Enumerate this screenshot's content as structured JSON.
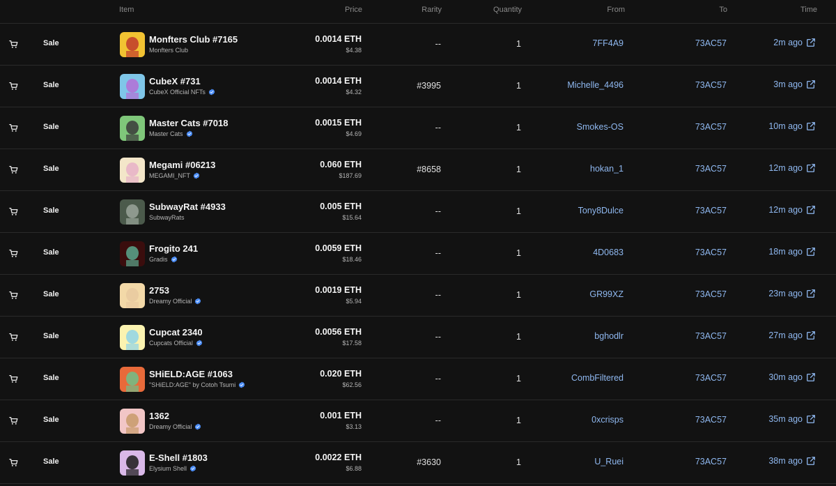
{
  "header": {
    "item": "Item",
    "price": "Price",
    "rarity": "Rarity",
    "quantity": "Quantity",
    "from": "From",
    "to": "To",
    "time": "Time"
  },
  "colors": {
    "background": "#121212",
    "link": "#8fb8f0",
    "verified": "#4c8ef7"
  },
  "rows": [
    {
      "event": "Sale",
      "name": "Monfters Club #7165",
      "collection": "Monfters Club",
      "verified": false,
      "price_eth": "0.0014 ETH",
      "price_usd": "$4.38",
      "rarity": "--",
      "quantity": "1",
      "from": "7FF4A9",
      "to": "73AC57",
      "time": "2m ago",
      "thumb_colors": [
        "#f1c232",
        "#c0392b"
      ]
    },
    {
      "event": "Sale",
      "name": "CubeX #731",
      "collection": "CubeX Official NFTs",
      "verified": true,
      "price_eth": "0.0014 ETH",
      "price_usd": "$4.32",
      "rarity": "#3995",
      "quantity": "1",
      "from": "Michelle_4496",
      "to": "73AC57",
      "time": "3m ago",
      "thumb_colors": [
        "#7fc6e8",
        "#b46fd6"
      ]
    },
    {
      "event": "Sale",
      "name": "Master Cats #7018",
      "collection": "Master Cats",
      "verified": true,
      "price_eth": "0.0015 ETH",
      "price_usd": "$4.69",
      "rarity": "--",
      "quantity": "1",
      "from": "Smokes-OS",
      "to": "73AC57",
      "time": "10m ago",
      "thumb_colors": [
        "#7fc77a",
        "#3a3a3a"
      ]
    },
    {
      "event": "Sale",
      "name": "Megami #06213",
      "collection": "MEGAMI_NFT",
      "verified": true,
      "price_eth": "0.060 ETH",
      "price_usd": "$187.69",
      "rarity": "#8658",
      "quantity": "1",
      "from": "hokan_1",
      "to": "73AC57",
      "time": "12m ago",
      "thumb_colors": [
        "#f3e6c9",
        "#e6b0c8"
      ]
    },
    {
      "event": "Sale",
      "name": "SubwayRat #4933",
      "collection": "SubwayRats",
      "verified": false,
      "price_eth": "0.005 ETH",
      "price_usd": "$15.64",
      "rarity": "--",
      "quantity": "1",
      "from": "Tony8Dulce",
      "to": "73AC57",
      "time": "12m ago",
      "thumb_colors": [
        "#4b5a4b",
        "#9aa59a"
      ]
    },
    {
      "event": "Sale",
      "name": "Frogito 241",
      "collection": "Gradis",
      "verified": true,
      "price_eth": "0.0059 ETH",
      "price_usd": "$18.46",
      "rarity": "--",
      "quantity": "1",
      "from": "4D0683",
      "to": "73AC57",
      "time": "18m ago",
      "thumb_colors": [
        "#3a0d0d",
        "#5aa88e"
      ]
    },
    {
      "event": "Sale",
      "name": "2753",
      "collection": "Dreamy Official",
      "verified": true,
      "price_eth": "0.0019 ETH",
      "price_usd": "$5.94",
      "rarity": "--",
      "quantity": "1",
      "from": "GR99XZ",
      "to": "73AC57",
      "time": "23m ago",
      "thumb_colors": [
        "#f3d9a8",
        "#e8c9a0"
      ]
    },
    {
      "event": "Sale",
      "name": "Cupcat 2340",
      "collection": "Cupcats Official",
      "verified": true,
      "price_eth": "0.0056 ETH",
      "price_usd": "$17.58",
      "rarity": "--",
      "quantity": "1",
      "from": "bghodlr",
      "to": "73AC57",
      "time": "27m ago",
      "thumb_colors": [
        "#fbf3b0",
        "#8fd3e8"
      ]
    },
    {
      "event": "Sale",
      "name": "SHiELD:AGE #1063",
      "collection": "\"SHiELD:AGE\" by Cotoh Tsumi",
      "verified": true,
      "price_eth": "0.020 ETH",
      "price_usd": "$62.56",
      "rarity": "--",
      "quantity": "1",
      "from": "CombFiltered",
      "to": "73AC57",
      "time": "30m ago",
      "thumb_colors": [
        "#e86a3a",
        "#6fbf8a"
      ]
    },
    {
      "event": "Sale",
      "name": "1362",
      "collection": "Dreamy Official",
      "verified": true,
      "price_eth": "0.001 ETH",
      "price_usd": "$3.13",
      "rarity": "--",
      "quantity": "1",
      "from": "0xcrisps",
      "to": "73AC57",
      "time": "35m ago",
      "thumb_colors": [
        "#f2c6c6",
        "#c89a6a"
      ]
    },
    {
      "event": "Sale",
      "name": "E-Shell #1803",
      "collection": "Elysium Shell",
      "verified": true,
      "price_eth": "0.0022 ETH",
      "price_usd": "$6.88",
      "rarity": "#3630",
      "quantity": "1",
      "from": "U_Ruei",
      "to": "73AC57",
      "time": "38m ago",
      "thumb_colors": [
        "#d9b8e8",
        "#1a1a1a"
      ]
    }
  ]
}
